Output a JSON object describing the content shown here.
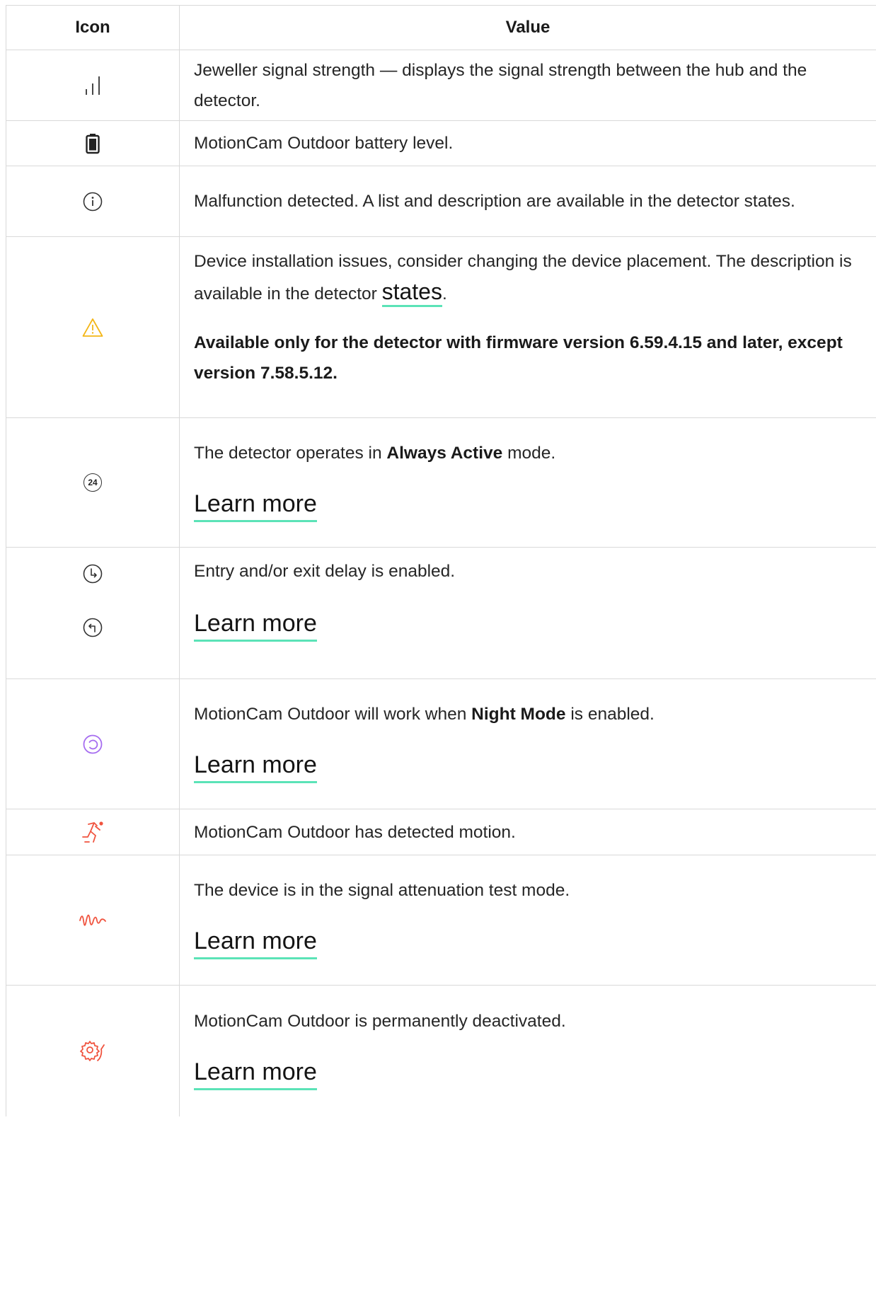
{
  "table": {
    "header": {
      "icon": "Icon",
      "value": "Value"
    },
    "rows": {
      "signal": {
        "icon": "signal-strength-icon",
        "text": "Jeweller signal strength — displays the signal strength between the hub and the detector."
      },
      "battery": {
        "icon": "battery-icon",
        "text": "MotionCam Outdoor battery level."
      },
      "malfunction": {
        "icon": "info-icon",
        "text": "Malfunction detected. A list and description are available in the detector states."
      },
      "installation": {
        "icon": "warning-icon",
        "text_before": "Device installation issues, consider changing the device placement. The description is available in the detector ",
        "link": "states",
        "text_after": ".",
        "note": "Available only for the detector with firmware version 6.59.4.15 and later, except version 7.58.5.12."
      },
      "always_active": {
        "icon": "always-active-24-icon",
        "icon_text": "24",
        "text_before": "The detector operates in ",
        "bold": "Always Active",
        "text_after": " mode.",
        "link": "Learn more"
      },
      "delay": {
        "icons": [
          "entry-delay-icon",
          "exit-delay-icon"
        ],
        "text": "Entry and/or exit delay is enabled.",
        "link": "Learn more"
      },
      "night_mode": {
        "icon": "night-mode-icon",
        "text_before": "MotionCam Outdoor will work when ",
        "bold": "Night Mode",
        "text_after": " is enabled.",
        "link": "Learn more"
      },
      "motion": {
        "icon": "motion-detected-icon",
        "text": "MotionCam Outdoor has detected motion."
      },
      "attenuation": {
        "icon": "signal-attenuation-icon",
        "text": "The device is in the signal attenuation test mode.",
        "link": "Learn more"
      },
      "deactivated": {
        "icon": "deactivated-icon",
        "text": "MotionCam Outdoor is permanently deactivated.",
        "link": "Learn more"
      }
    }
  },
  "colors": {
    "link_underline": "#5be3b7",
    "warning": "#f3b617",
    "night_mode": "#a66df0",
    "alert_red": "#f0533e",
    "border": "#d9d9d9"
  }
}
